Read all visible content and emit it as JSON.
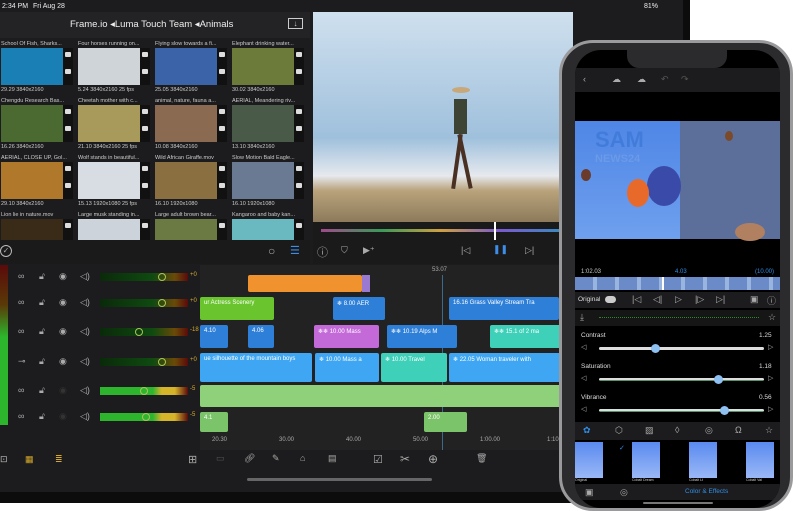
{
  "status": {
    "time": "2:34 PM",
    "date": "Fri Aug 28",
    "battery": "81%"
  },
  "browser": {
    "breadcrumb": "Frame.io ◂Luma Touch Team ◂Animals"
  },
  "clips": [
    {
      "title": "School Of Fish, Sharks...",
      "info": "29.29  3840x2160",
      "color": "#1a7fb5"
    },
    {
      "title": "Four horses running on...",
      "info": "5.24  3840x2160  25 fps",
      "color": "#cfd4d8"
    },
    {
      "title": "Flying slow towards a fi...",
      "info": "25.05  3840x2160",
      "color": "#3b64a8"
    },
    {
      "title": "Elephant drinking water...",
      "info": "30.02  3840x2160",
      "color": "#6c7a3a"
    },
    {
      "title": "Chengdu Research Bas...",
      "info": "16.26  3840x2160",
      "color": "#4a6a32"
    },
    {
      "title": "Cheetah mother with c...",
      "info": "21.10  3840x2160  25 fps",
      "color": "#a89a5a"
    },
    {
      "title": "animal, nature, fauna a...",
      "info": "10.08  3840x2160",
      "color": "#8a6a50"
    },
    {
      "title": "AERIAL, Meandering riv...",
      "info": "13.10  3840x2160",
      "color": "#4a5a48"
    },
    {
      "title": "AERIAL, CLOSE UP, Gol...",
      "info": "29.10  3840x2160",
      "color": "#b0782a"
    },
    {
      "title": "Wolf stands in beautiful...",
      "info": "15.13  1920x1080  25 fps",
      "color": "#d8dde4"
    },
    {
      "title": "Wild African Giraffe.mov",
      "info": "16.10  1920x1080",
      "color": "#8a7040"
    },
    {
      "title": "Slow Motion Bald Eagle...",
      "info": "16.10  1920x1080",
      "color": "#6a7a92"
    },
    {
      "title": "Lion lie in nature.mov",
      "info": "",
      "color": "#3a2a18"
    },
    {
      "title": "Large musk standing in...",
      "info": "",
      "color": "#cdd3da"
    },
    {
      "title": "Large adult brown bear...",
      "info": "",
      "color": "#6a7a42"
    },
    {
      "title": "Kangaroo and baby kan...",
      "info": "",
      "color": "#6ab8c0"
    }
  ],
  "viewer": {
    "timecode": "53.07"
  },
  "tracks": [
    {
      "level": "+0"
    },
    {
      "level": "+0"
    },
    {
      "level": "-18"
    },
    {
      "level": "+0"
    },
    {
      "level": "-5"
    },
    {
      "level": "-5"
    }
  ],
  "timeline": {
    "clips": [
      {
        "row": 0,
        "label": "",
        "color": "#f0922e"
      },
      {
        "row": 1,
        "label": "ur Actress Scenery",
        "color": "#6ac42e"
      },
      {
        "row": 1,
        "label": "❄ 8.00  AER",
        "color": "#2e7fd8"
      },
      {
        "row": 1,
        "label": "16.16  Grass Valley Stream Tra",
        "color": "#2e7fd8"
      },
      {
        "row": 2,
        "label": "4.10",
        "color": "#2e7fd8"
      },
      {
        "row": 2,
        "label": "4.06",
        "color": "#2e7fd8"
      },
      {
        "row": 2,
        "label": "❄❄ 10.00  Mass",
        "color": "#c36ad8"
      },
      {
        "row": 2,
        "label": "❄❄ 10.19  Alps M",
        "color": "#2e7fd8"
      },
      {
        "row": 2,
        "label": "❄❄ 15.1  of 2 ma",
        "color": "#3ed0b8"
      },
      {
        "row": 3,
        "label": "ue silhouette of the mountain boys",
        "color": "#3ea6f2"
      },
      {
        "row": 3,
        "label": "❄ 10.00  Mass a",
        "color": "#3ea6f2"
      },
      {
        "row": 3,
        "label": "❄ 10.00  Travel",
        "color": "#3ed0b8"
      },
      {
        "row": 3,
        "label": "❄ 22.05  Woman traveler with",
        "color": "#3ea6f2"
      },
      {
        "row": 4,
        "label": "",
        "color": "#8fd07a"
      },
      {
        "row": 5,
        "label": "4.1",
        "color": "#7cc46a"
      },
      {
        "row": 5,
        "label": "2.00",
        "color": "#7cc46a"
      }
    ],
    "ruler": [
      "20.30",
      "30.00",
      "40.00",
      "50.00",
      "1:00.00",
      "1:10.00"
    ]
  },
  "phone": {
    "timecodes": {
      "start": "1:02.03",
      "current": "4.03",
      "end": "(10.00)"
    },
    "original_label": "Original",
    "watermark": {
      "line1": "SAM",
      "line2": "NEWS24"
    },
    "sliders": [
      {
        "label": "Contrast",
        "value": "1.25",
        "fraction": 0.34
      },
      {
        "label": "Saturation",
        "value": "1.18",
        "fraction": 0.72
      },
      {
        "label": "Vibrance",
        "value": "0.56",
        "fraction": 0.76
      }
    ],
    "filters": [
      "Original",
      "Cobalt Dream",
      "Cobalt Lt",
      "Cobalt Val"
    ],
    "bottom_tab": "Color & Effects",
    "accent": "#2f8fe8"
  }
}
